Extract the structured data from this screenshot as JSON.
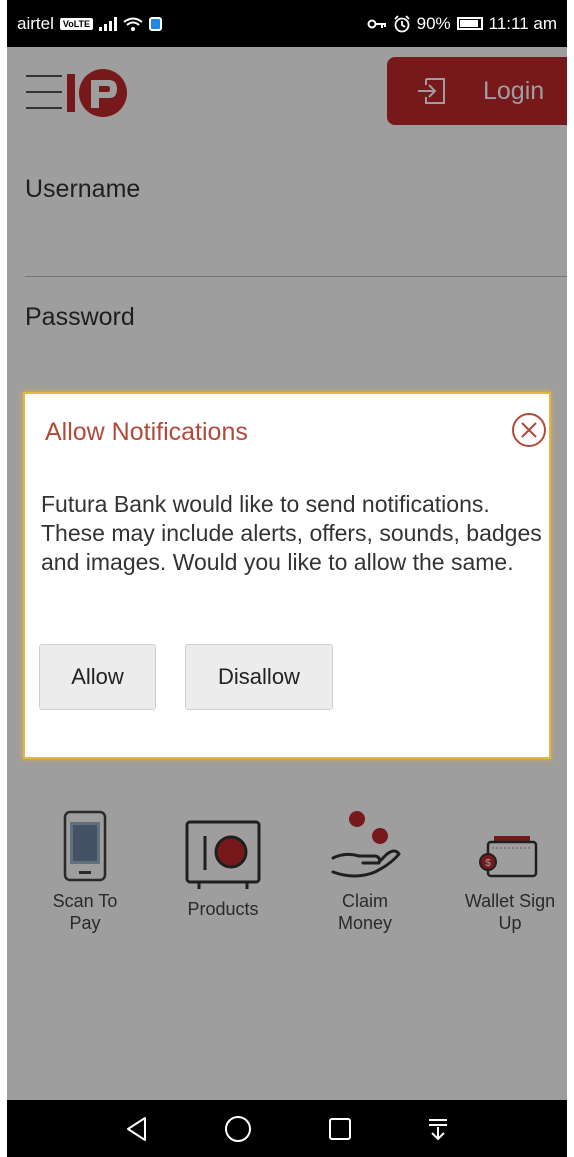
{
  "status_bar": {
    "carrier": "airtel",
    "volte_badge": "VoLTE",
    "battery": "90%",
    "time": "11:11 am",
    "icons": [
      "signal-icon",
      "wifi-icon",
      "shield-icon",
      "key-icon",
      "alarm-icon",
      "battery-icon"
    ]
  },
  "header": {
    "menu_icon": "hamburger-icon",
    "logo_icon": "futura-logo-icon",
    "login_label": "Login",
    "login_icon": "login-arrow-icon"
  },
  "form": {
    "username_label": "Username",
    "password_label": "Password"
  },
  "tiles": [
    {
      "label_line1": "Scan To",
      "label_line2": "Pay",
      "icon": "qr-phone-icon"
    },
    {
      "label_line1": "Products",
      "label_line2": "",
      "icon": "safe-icon"
    },
    {
      "label_line1": "Claim",
      "label_line2": "Money",
      "icon": "hand-coins-icon"
    },
    {
      "label_line1": "Wallet Sign",
      "label_line2": "Up",
      "icon": "wallet-icon"
    }
  ],
  "dialog": {
    "title": "Allow Notifications",
    "body": "Futura Bank would like to send notifications. These may include alerts, offers, sounds, badges and images. Would you like to allow the same.",
    "allow_label": "Allow",
    "disallow_label": "Disallow",
    "close_icon": "close-circle-icon"
  },
  "nav_bar": {
    "icons": [
      "back-icon",
      "home-icon",
      "recents-icon",
      "notification-pull-icon"
    ]
  },
  "colors": {
    "brand_red": "#c1272d",
    "dialog_title": "#b14a3b",
    "dialog_border": "#e6b640"
  }
}
